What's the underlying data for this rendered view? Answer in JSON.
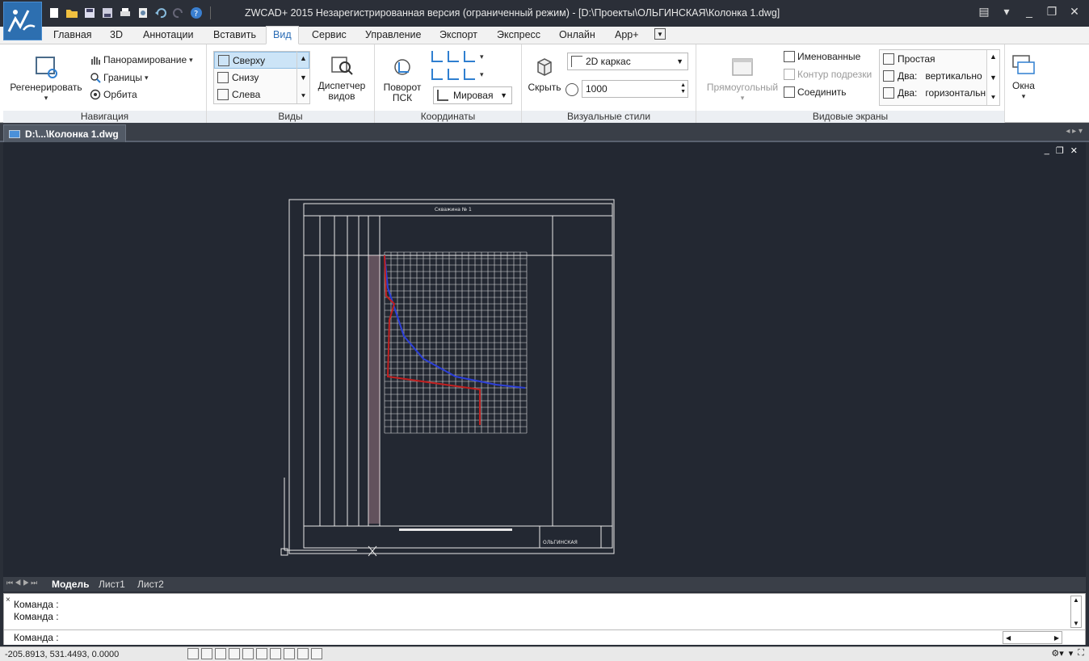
{
  "window": {
    "title": "ZWCAD+ 2015 Незарегистрированная версия (ограниченный режим) - [D:\\Проекты\\ОЛЬГИНСКАЯ\\Колонка 1.dwg]"
  },
  "ribbon_tabs": [
    "Главная",
    "3D",
    "Аннотации",
    "Вставить",
    "Вид",
    "Сервис",
    "Управление",
    "Экспорт",
    "Экспресс",
    "Онлайн",
    "App+"
  ],
  "active_tab": "Вид",
  "panels": {
    "navigation": {
      "title": "Навигация",
      "regen": "Регенерировать",
      "pan": "Панорамирование",
      "extents": "Границы",
      "orbit": "Орбита"
    },
    "views": {
      "title": "Виды",
      "items": [
        "Сверху",
        "Снизу",
        "Слева"
      ],
      "manager": "Диспетчер видов"
    },
    "coords": {
      "title": "Координаты",
      "rotate_ucs": "Поворот ПСК",
      "world": "Мировая"
    },
    "visual_styles": {
      "title": "Визуальные стили",
      "hide": "Скрыть",
      "style": "2D каркас",
      "value": "1000"
    },
    "viewports": {
      "title": "Видовые экраны",
      "rect": "Прямоугольный",
      "named": "Именованные",
      "clip": "Контур подрезки",
      "join": "Соединить",
      "layouts": [
        "Простая",
        "Два:   вертикально",
        "Два:   горизонтальн"
      ]
    },
    "windows": {
      "label": "Окна"
    }
  },
  "document_tab": "D:\\...\\Колонка 1.dwg",
  "drawing": {
    "title": "Скважина № 1",
    "stamp": "ОЛЬГИНСКАЯ"
  },
  "layout_tabs": [
    "Модель",
    "Лист1",
    "Лист2"
  ],
  "command": {
    "history": [
      "Команда :",
      "Команда :"
    ],
    "prompt": "Команда :"
  },
  "status": {
    "coords": "-205.8913, 531.4493, 0.0000"
  }
}
